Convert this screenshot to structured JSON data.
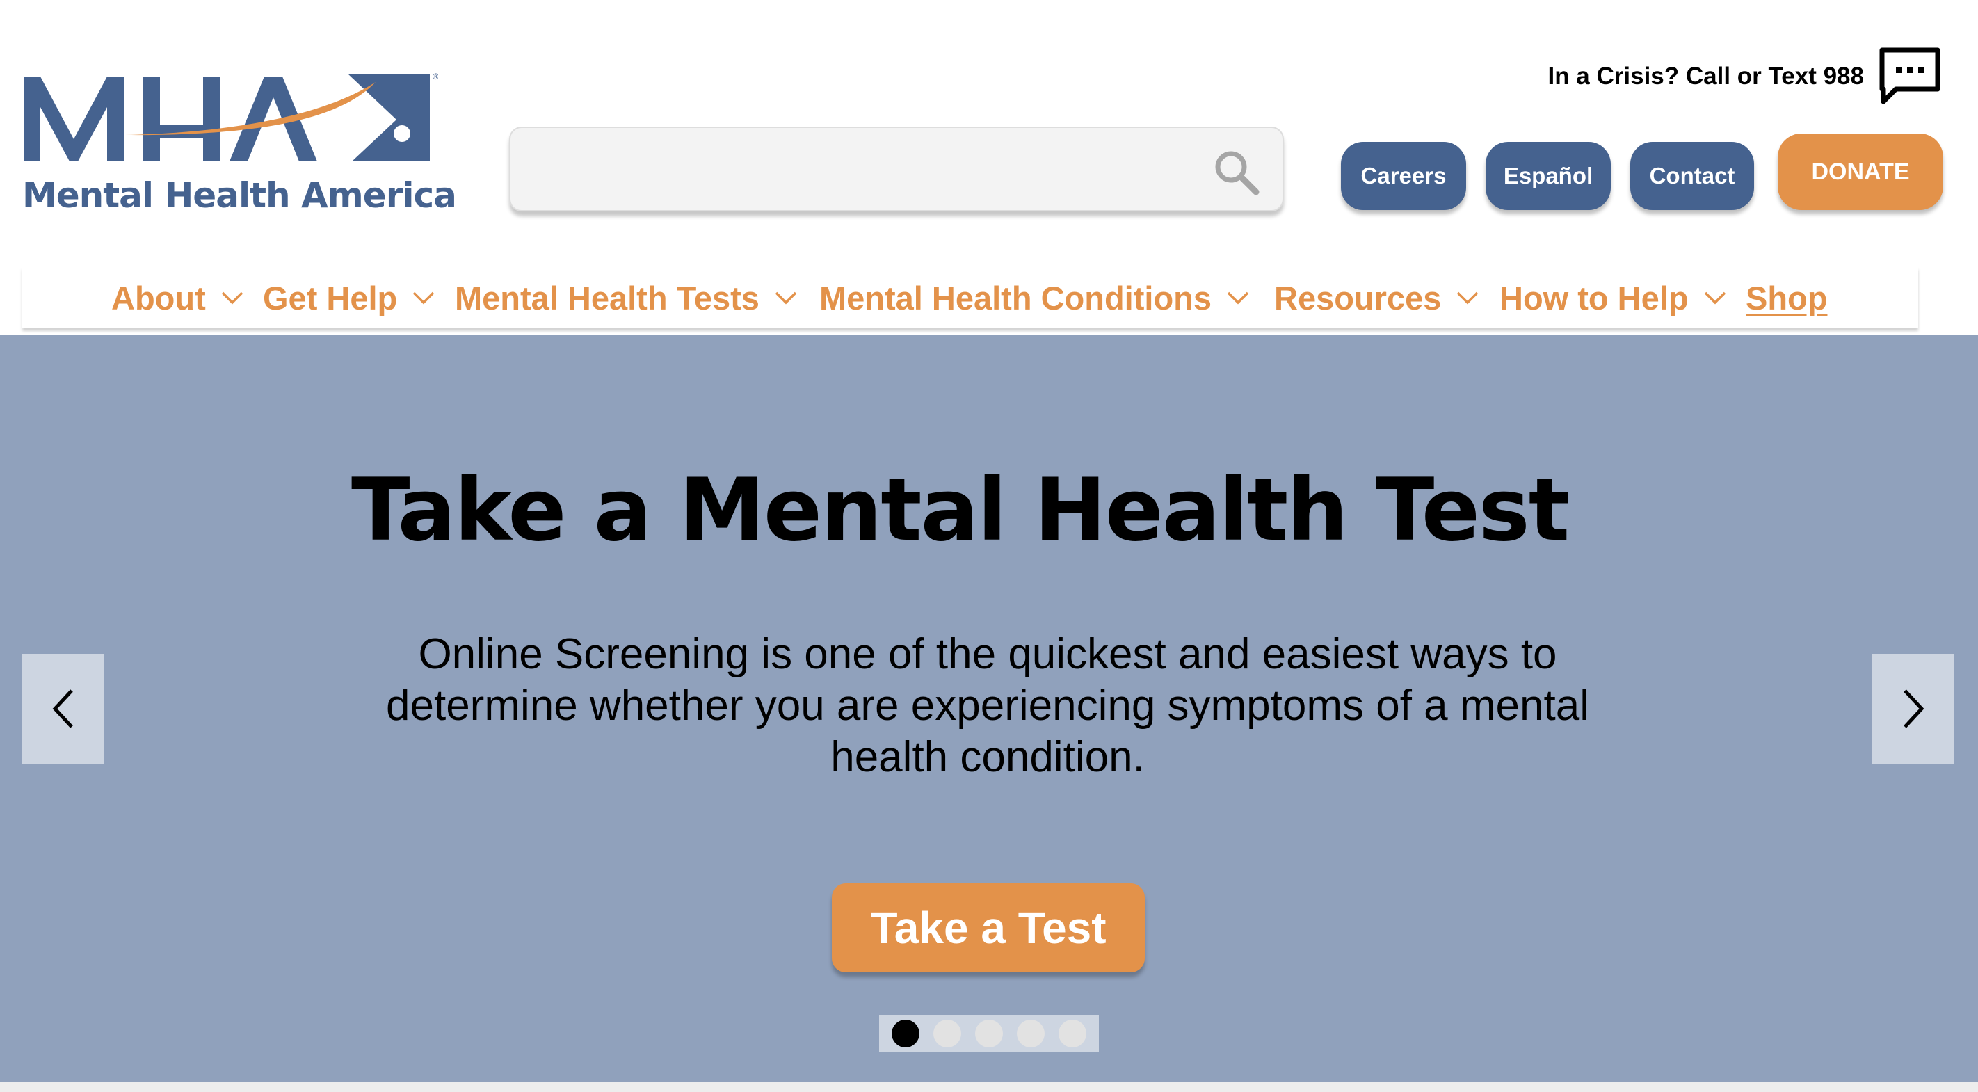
{
  "header": {
    "logo_letters": "MHA",
    "logo_name": "Mental Health America",
    "search_placeholder": "",
    "crisis_text": "In a Crisis? Call or Text 988",
    "buttons": {
      "careers": "Careers",
      "espanol": "Español",
      "contact": "Contact",
      "donate": "DONATE"
    }
  },
  "nav": {
    "items": [
      {
        "label": "About",
        "dropdown": true
      },
      {
        "label": "Get Help",
        "dropdown": true
      },
      {
        "label": "Mental Health Tests",
        "dropdown": true
      },
      {
        "label": "Mental Health Conditions",
        "dropdown": true
      },
      {
        "label": "Resources",
        "dropdown": true
      },
      {
        "label": "How to Help",
        "dropdown": true
      },
      {
        "label": "Shop",
        "dropdown": false
      }
    ]
  },
  "hero": {
    "title": "Take a Mental Health Test",
    "text": "Online Screening is one of the quickest and easiest ways to determine whether you are experiencing symptoms of a mental health condition.",
    "cta": "Take a Test",
    "slide_count": 5,
    "active_slide": 1
  },
  "colors": {
    "brand_blue": "#45628f",
    "brand_orange": "#e3924a",
    "hero_background": "#90a1bc"
  },
  "icons": [
    "search-icon",
    "chat-icon",
    "chevron-down-icon",
    "chevron-left-icon",
    "chevron-right-icon"
  ]
}
